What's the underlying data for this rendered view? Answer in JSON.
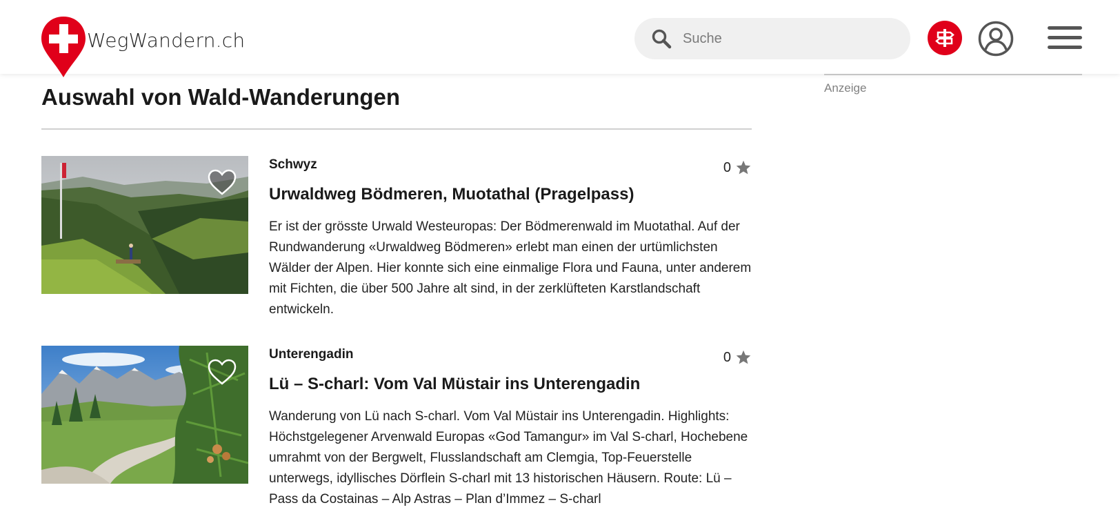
{
  "header": {
    "logo_text": "WegWandern.ch",
    "search_placeholder": "Suche",
    "brand_color": "#e0001a",
    "icons": [
      "logo-swiss-pin",
      "search-icon",
      "signpost-icon",
      "user-icon",
      "hamburger-menu-icon"
    ]
  },
  "sidebar": {
    "ad_label": "Anzeige"
  },
  "main": {
    "title": "Auswahl von Wald-Wanderungen",
    "hikes": [
      {
        "region": "Schwyz",
        "rating": "0",
        "title": "Urwaldweg Bödmeren, Muotathal (Pragelpass)",
        "description": "Er ist der grösste Urwald Westeuropas: Der Bödmerenwald im Muotathal. Auf der Rundwanderung «Urwaldweg Bödmeren» erlebt man einen der urtümlichsten Wälder der Alpen. Hier konnte sich eine einmalige Flora und Fauna, unter anderem mit Fichten, die über 500 Jahre alt sind, in der zerklüfteten Karstlandschaft entwickeln.",
        "image": "mountain-valley-photo"
      },
      {
        "region": "Unterengadin",
        "rating": "0",
        "title": "Lü – S-charl: Vom Val Müstair ins Unterengadin",
        "description": "Wanderung von Lü nach S-charl. Vom Val Müstair ins Unterengadin. Highlights: Höchstgelegener Arvenwald Europas «God Tamangur» im Val S-charl, Hochebene umrahmt von der Bergwelt, Flusslandschaft am Clemgia, Top-Feuerstelle unterwegs, idyllisches Dörflein S-charl mit 13 historischen Häusern. Route: Lü – Pass da Costainas – Alp Astras – Plan d’Immez – S-charl",
        "image": "alpine-trail-photo"
      }
    ]
  }
}
